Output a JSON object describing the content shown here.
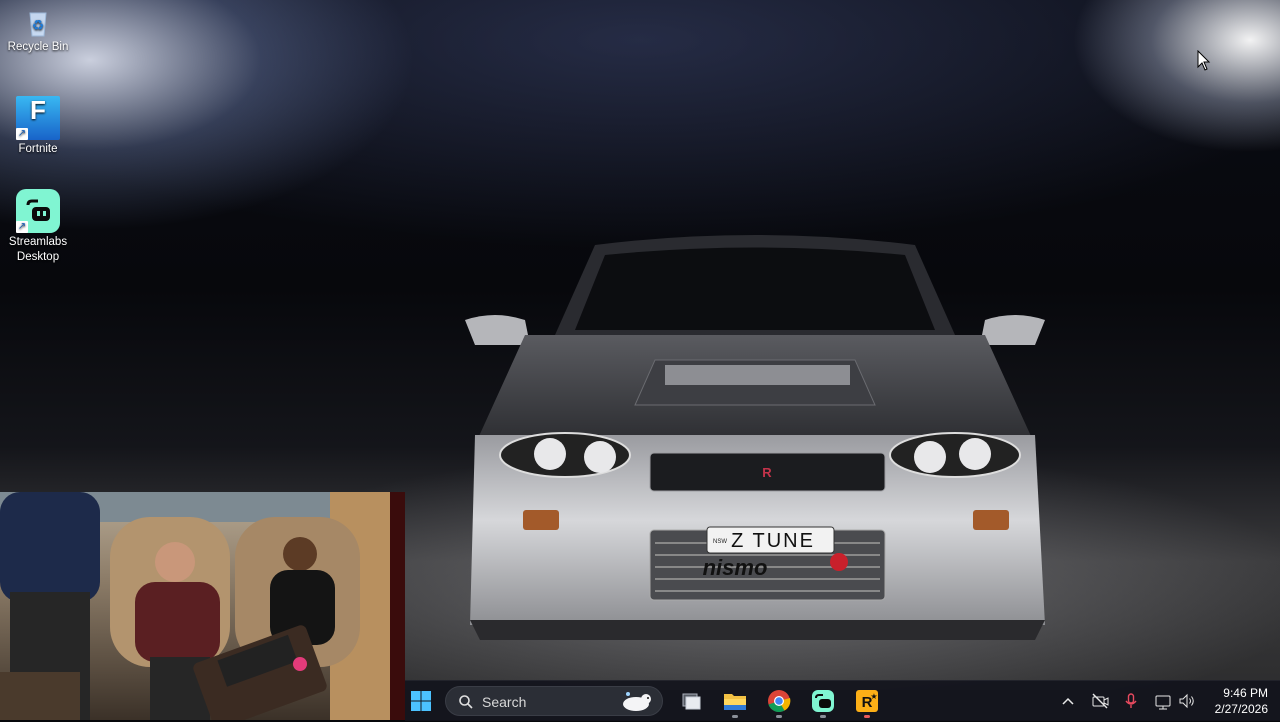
{
  "desktop": {
    "icons": [
      {
        "label": "Recycle Bin",
        "icon": "recycle-bin-icon"
      },
      {
        "label": "Fortnite",
        "icon": "fortnite-icon"
      },
      {
        "label": "Streamlabs Desktop",
        "icon": "streamlabs-icon"
      }
    ]
  },
  "wallpaper": {
    "plate_text": "Z TUNE",
    "plate_side": "NSW",
    "grille_badge": "nismo"
  },
  "taskbar": {
    "start_icon": "windows-start-icon",
    "search_label": "Search",
    "apps": [
      {
        "name": "task-view-icon"
      },
      {
        "name": "file-explorer-icon"
      },
      {
        "name": "chrome-icon"
      },
      {
        "name": "streamlabs-taskbar-icon"
      },
      {
        "name": "rockstar-launcher-icon"
      }
    ],
    "tray": {
      "show_hidden": "^",
      "time": "9:46 PM",
      "date": "2/27/2026"
    }
  },
  "colors": {
    "taskbar_bg": "#12141c",
    "accent_start": "#4cc2ff",
    "streamlabs": "#80f5d2",
    "rockstar": "#fcaf17"
  }
}
